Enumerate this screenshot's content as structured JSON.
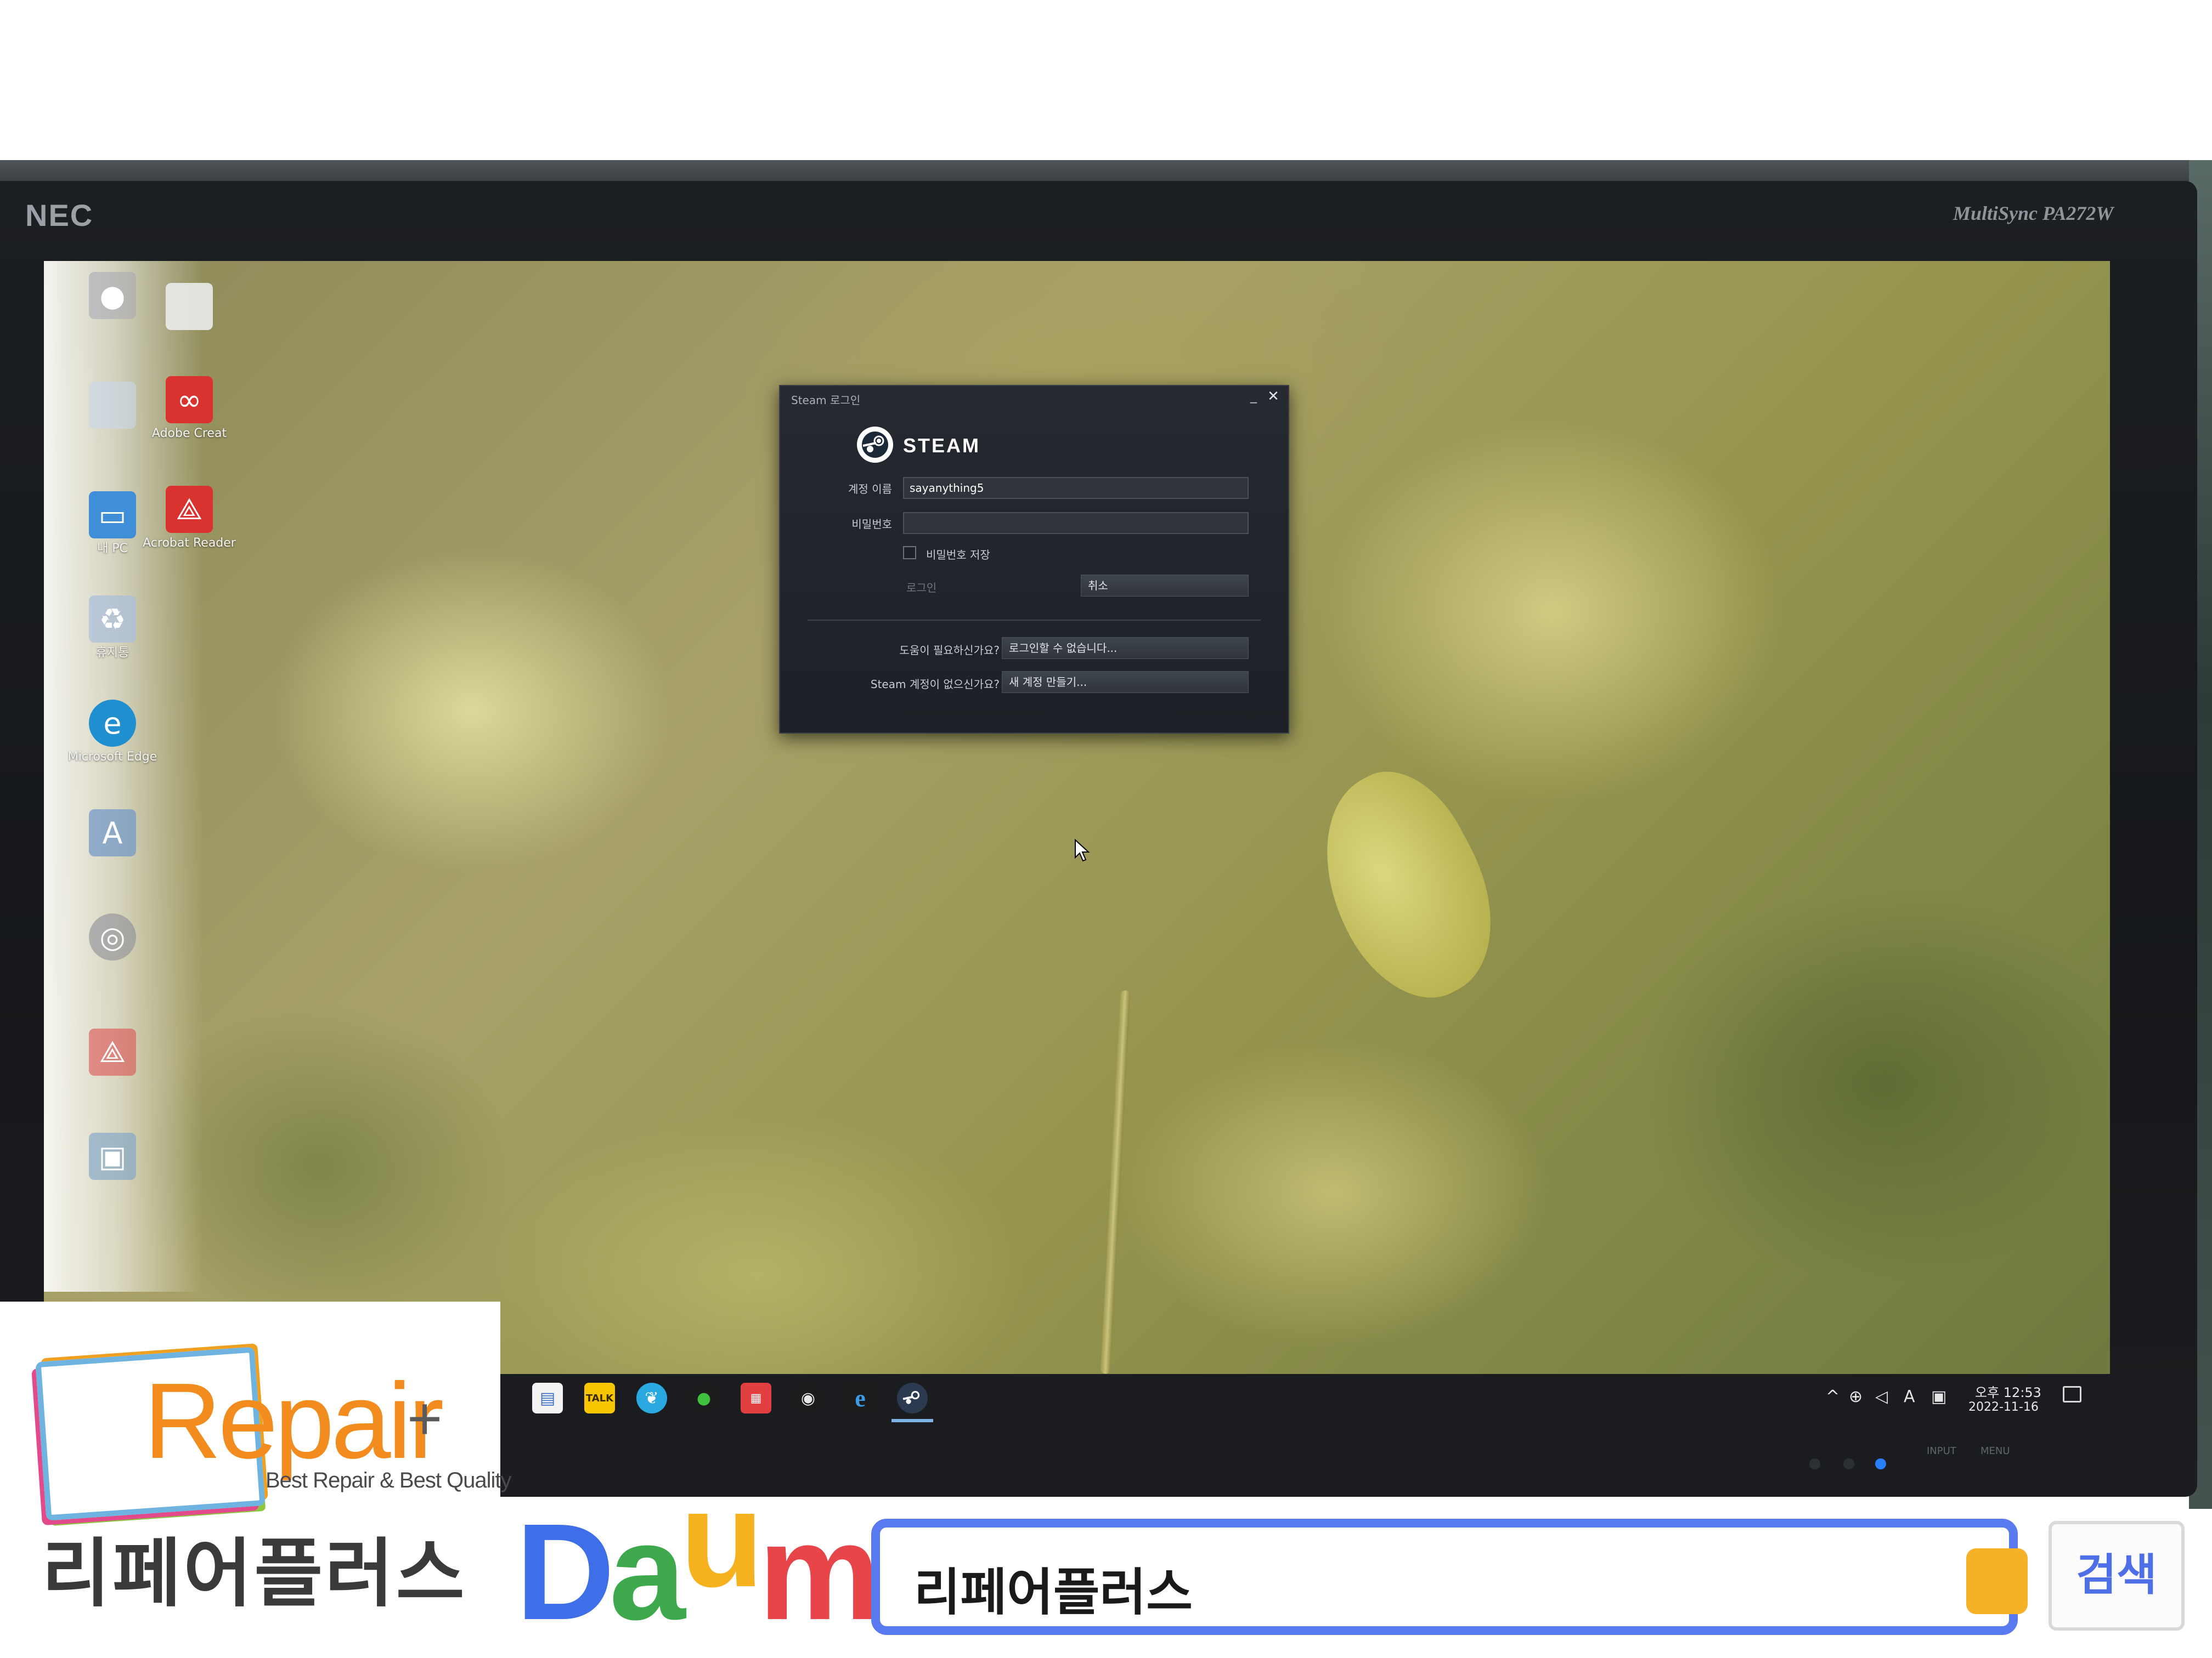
{
  "monitor": {
    "brand": "NEC",
    "model": "MultiSync PA272W",
    "chin_labels": [
      "INPUT",
      "MENU"
    ]
  },
  "desktop": {
    "icons": [
      {
        "label": "",
        "icon": "user-folder-icon"
      },
      {
        "label": "",
        "icon": "blank-file-icon"
      },
      {
        "label": "",
        "icon": "blank-icon"
      },
      {
        "label": "Adobe Creat",
        "icon": "adobe-creative-cloud-icon"
      },
      {
        "label": "내 PC",
        "icon": "this-pc-icon"
      },
      {
        "label": "Acrobat Reader",
        "icon": "acrobat-reader-icon"
      },
      {
        "label": "휴지통",
        "icon": "recycle-bin-icon"
      },
      {
        "label": "Microsoft Edge",
        "icon": "edge-icon"
      },
      {
        "label": "",
        "icon": "app-icon"
      },
      {
        "label": "",
        "icon": "app-icon"
      },
      {
        "label": "",
        "icon": "acrobat-icon"
      },
      {
        "label": "",
        "icon": "app-icon"
      }
    ]
  },
  "steam_login": {
    "window_title": "Steam 로그인",
    "minimize": "_",
    "close": "✕",
    "brand": "STEAM",
    "account_label": "계정 이름",
    "account_value": "sayanything5",
    "password_label": "비밀번호",
    "password_value": "",
    "remember_label": "비밀번호 저장",
    "remember_checked": false,
    "login_button": "로그인",
    "cancel_button": "취소",
    "help_question": "도움이 필요하신가요?",
    "help_button": "로그인할 수 없습니다...",
    "no_account_question": "Steam 계정이 없으신가요?",
    "create_account_button": "새 계정 만들기..."
  },
  "taskbar": {
    "apps": [
      {
        "icon": "notepad-icon",
        "label": ""
      },
      {
        "icon": "kakaotalk-icon",
        "label": "TALK"
      },
      {
        "icon": "bird-app-icon",
        "label": ""
      },
      {
        "icon": "green-app-icon",
        "label": ""
      },
      {
        "icon": "pdf-app-icon",
        "label": ""
      },
      {
        "icon": "chrome-like-icon",
        "label": ""
      },
      {
        "icon": "internet-explorer-icon",
        "label": "e"
      },
      {
        "icon": "steam-icon",
        "label": ""
      }
    ],
    "tray": {
      "chevron": "^",
      "ime": "A",
      "time": "오후 12:53",
      "date": "2022-11-16"
    }
  },
  "overlay": {
    "logo_word": "Repair",
    "logo_plus": "+",
    "logo_tagline": "Best Repair & Best Quality",
    "logo_korean": "리페어플러스",
    "search_engine": {
      "d": "D",
      "a": "a",
      "u": "u",
      "m": "m"
    },
    "search_query": "리페어플러스",
    "search_button": "검색"
  },
  "colors": {
    "steam_bg": "#1d2026",
    "search_border": "#5a7bef",
    "logo_orange": "#f28c1e"
  }
}
